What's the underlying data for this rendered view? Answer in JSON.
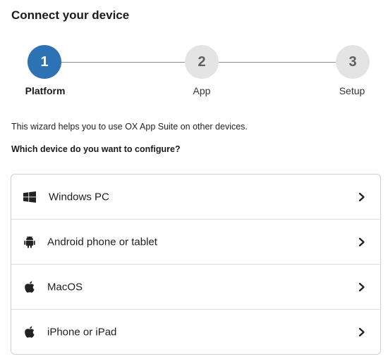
{
  "dialog": {
    "title": "Connect your device"
  },
  "stepper": {
    "steps": [
      {
        "number": "1",
        "label": "Platform",
        "state": "active"
      },
      {
        "number": "2",
        "label": "App",
        "state": "inactive"
      },
      {
        "number": "3",
        "label": "Setup",
        "state": "inactive"
      }
    ],
    "active_color": "#2e72b6",
    "inactive_color": "#e4e4e4"
  },
  "intro_text": "This wizard helps you to use OX App Suite on other devices.",
  "question_text": "Which device do you want to configure?",
  "devices": [
    {
      "label": "Windows PC",
      "icon": "windows-icon"
    },
    {
      "label": "Android phone or tablet",
      "icon": "android-icon"
    },
    {
      "label": "MacOS",
      "icon": "apple-icon"
    },
    {
      "label": "iPhone or iPad",
      "icon": "apple-icon"
    }
  ]
}
